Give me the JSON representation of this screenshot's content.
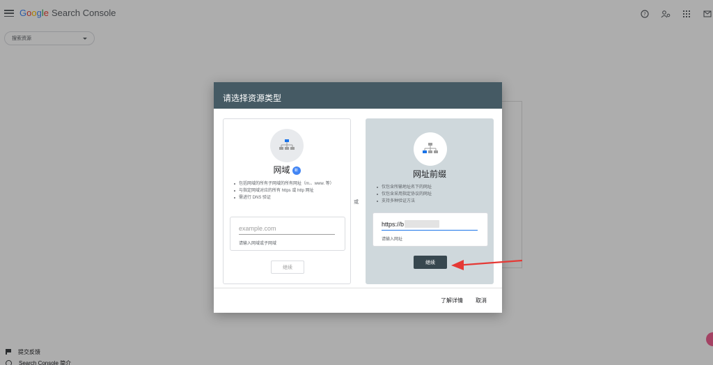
{
  "app": {
    "logo_letters": [
      "G",
      "o",
      "o",
      "g",
      "l",
      "e"
    ],
    "product_name": "Search Console",
    "property_select_placeholder": "搜索资源"
  },
  "bottom_links": {
    "feedback": "提交反馈",
    "about": "Search Console 简介"
  },
  "dialog": {
    "title": "请选择资源类型",
    "or_label": "或",
    "domain_card": {
      "title": "网域",
      "new_badge": "新",
      "bullets": [
        "包括网域的所有子网域的所有网址（m.、www. 等）",
        "与指定网域对应的所有 https 或 http 网址",
        "需进行 DNS 验证"
      ],
      "input_placeholder": "example.com",
      "input_hint": "请输入网域或子网域",
      "continue_label": "继续"
    },
    "url_prefix_card": {
      "title": "网址前缀",
      "bullets": [
        "仅包含所输地址名下的网址",
        "仅包含采用指定协议的网址",
        "支持多种验证方法"
      ],
      "input_value": "https://b              om",
      "input_hint": "请输入网址",
      "continue_label": "继续"
    },
    "footer": {
      "learn_more": "了解详情",
      "cancel": "取消"
    }
  },
  "colors": {
    "header_bg": "#455a64",
    "selected_card_bg": "#cfd8dc",
    "primary_button": "#37474f",
    "annotation_arrow": "#e53935",
    "accent_blue": "#1a73e8"
  }
}
